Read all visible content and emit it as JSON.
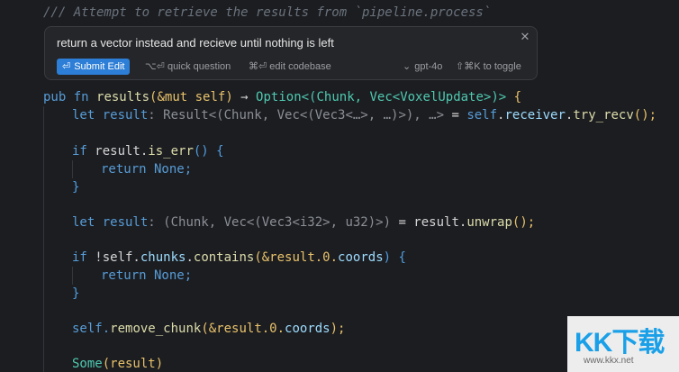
{
  "editor": {
    "comment_line": "/// Attempt to retrieve the results from `pipeline.process`",
    "fn_keywords": "pub fn",
    "fn_name": "results",
    "fn_params": "(&mut self)",
    "fn_arrow": " → ",
    "fn_return": "Option<(Chunk, Vec<VoxelUpdate>)>",
    "fn_open": " {",
    "line1_let": "let result",
    "line1_hint": ": Result<(Chunk, Vec<(Vec3<…>, …)>), …>",
    "line1_rhs_eq": " = ",
    "line1_self": "self",
    "line1_dot1": ".",
    "line1_receiver": "receiver",
    "line1_dot2": ".",
    "line1_method": "try_recv",
    "line1_call": "();",
    "if1_kw": "if",
    "if1_expr": " result.",
    "if1_method": "is_err",
    "if1_tail": "() {",
    "return_none": "return None;",
    "close_brace": "}",
    "line2_let": "let result",
    "line2_hint": ": (Chunk, Vec<(Vec3<i32>, u32)>)",
    "line2_eq": " = result.",
    "line2_method": "unwrap",
    "line2_call": "();",
    "if2_kw": "if",
    "if2_expr": " !self.",
    "if2_prop": "chunks",
    "if2_dot": ".",
    "if2_method": "contains",
    "if2_args": "(&result.0.",
    "if2_coords": "coords",
    "if2_tail": ") {",
    "remove_self": "self.",
    "remove_method": "remove_chunk",
    "remove_args": "(&result.0.",
    "remove_coords": "coords",
    "remove_tail": ");",
    "some_kw": "Some",
    "some_args": "(result)"
  },
  "prompt": {
    "text": "return a vector instead and recieve until nothing is left",
    "close_icon": "close-icon",
    "submit_label": "Submit Edit",
    "submit_icon": "enter-icon",
    "quick_question": "⌥⏎ quick question",
    "edit_codebase": "⌘⏎ edit codebase",
    "model_chevron": "⌄",
    "model_label": "gpt-4o",
    "toggle_hint": "⇧⌘K to toggle"
  },
  "watermark": {
    "logo": "KK下载",
    "url": "www.kkx.net"
  }
}
